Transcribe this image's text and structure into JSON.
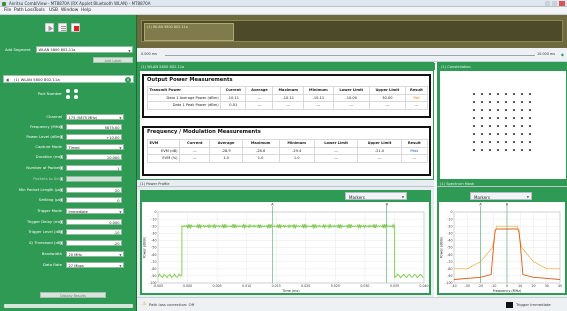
{
  "window": {
    "title": "Anritsu CombiView - MT8870A (RX Applet Bluetooth WLAN) - MT8870A"
  },
  "menu": [
    "File",
    "Path Loss",
    "Tools",
    "USB",
    "Window",
    "Help"
  ],
  "left_panel": {
    "add_segment_label": "Add Segment",
    "add_segment_value": "WLAN 5800 802.11a",
    "add_label_btn": "Add Label",
    "segment_title": "(1) WLAN 5800 802.11a",
    "rows": [
      {
        "label": "Port Number",
        "value": ""
      },
      {
        "label": "Channel",
        "value": "175 (5875 MHz)"
      },
      {
        "label": "Frequency (MHz)",
        "value": "5875.00"
      },
      {
        "label": "Power Level (dBm)",
        "value": "+10.00"
      },
      {
        "label": "Capture Mode",
        "value": "Timed"
      },
      {
        "label": "Duration (ms)",
        "value": "10.000"
      },
      {
        "label": "Number of Packets",
        "value": "1"
      },
      {
        "label": "Packets to Skip",
        "value": ""
      },
      {
        "label": "Min Packet Length (μs)",
        "value": "20"
      },
      {
        "label": "Settling (μs)",
        "value": "0"
      },
      {
        "label": "Trigger Mode",
        "value": "Immediate"
      },
      {
        "label": "Trigger Delay (ms)",
        "value": "0.000"
      },
      {
        "label": "Trigger Level (dB)",
        "value": "-10"
      },
      {
        "label": "IQ Threshold (dB)",
        "value": "-20"
      },
      {
        "label": "Bandwidth",
        "value": "20 MHz"
      },
      {
        "label": "Data Rate",
        "value": "27 Mbps"
      }
    ],
    "display_results": "Display Results"
  },
  "timeline": {
    "segment_label": "(1) WLAN 5800 802.11a",
    "start": "0.000 ms",
    "end": "10.000 ms"
  },
  "meas_panel_title": "(1) WLAN 5800 802.11a",
  "constellation_title": "(1) Constellation",
  "output_power": {
    "title": "Output Power Measurements",
    "headers": [
      "Transmit Power",
      "Current",
      "Average",
      "Maximum",
      "Minimum",
      "Lower Limit",
      "Upper Limit",
      "Result"
    ],
    "rows": [
      [
        "Data 1 Average Power (dBm)",
        "-10.11",
        "---",
        "-10.11",
        "-10.11",
        "-10.00",
        "30.00",
        "Fail"
      ],
      [
        "Data 1 Peak Power (dBm)",
        "0.01",
        "---",
        "---",
        "---",
        "---",
        "---",
        "---"
      ]
    ]
  },
  "freq_mod": {
    "title": "Frequency / Modulation Measurements",
    "headers": [
      "EVM",
      "Current",
      "Average",
      "Maximum",
      "Minimum",
      "Lower Limit",
      "Upper Limit",
      "Result"
    ],
    "rows": [
      [
        "EVM (dB)",
        "---",
        "-28.9",
        "-28.6",
        "-29.4",
        "---",
        "-21.0",
        "Pass"
      ],
      [
        "EVM (%)",
        "---",
        "1.0",
        "1.0",
        "1.0",
        "---",
        "---",
        "---"
      ]
    ]
  },
  "power_profile": {
    "tab": "(1) Power Profile",
    "markers": "Markers",
    "ylabel": "Power (dBm)",
    "xlabel": "Time (ms)",
    "marker_labels": [
      "A",
      "B"
    ],
    "yticks": [
      "0",
      "-10",
      "-20",
      "-30",
      "-40",
      "-50",
      "-60",
      "-70",
      "-80",
      "-90",
      "-100"
    ],
    "xticks": [
      "-0.005",
      "0.000",
      "0.005",
      "0.010",
      "0.015",
      "0.020",
      "0.025",
      "0.030",
      "0.035",
      "0.040"
    ]
  },
  "spectrum": {
    "tab": "(1) Spectrum Mask",
    "markers": "Markers",
    "ylabel": "Power (dBm)",
    "xlabel": "Frequency (MHz)",
    "marker_labels": [
      "A",
      "B"
    ],
    "yticks": [
      "0",
      "-10",
      "-20",
      "-30",
      "-40",
      "-50",
      "-60",
      "-70",
      "-80",
      "-90",
      "-100"
    ],
    "xticks": [
      "-40",
      "-30",
      "-20",
      "-10",
      "0",
      "10",
      "20",
      "30",
      "40"
    ]
  },
  "status": {
    "path_loss": "Path loss correction: Off",
    "trigger": "Trigger Immediate"
  },
  "colors": {
    "panel_green": "#2f9a54",
    "trace_green": "#7ec850",
    "mask_orange": "#e8a030",
    "fail_orange": "#d07a00",
    "pass_blue": "#1a5fb4"
  }
}
